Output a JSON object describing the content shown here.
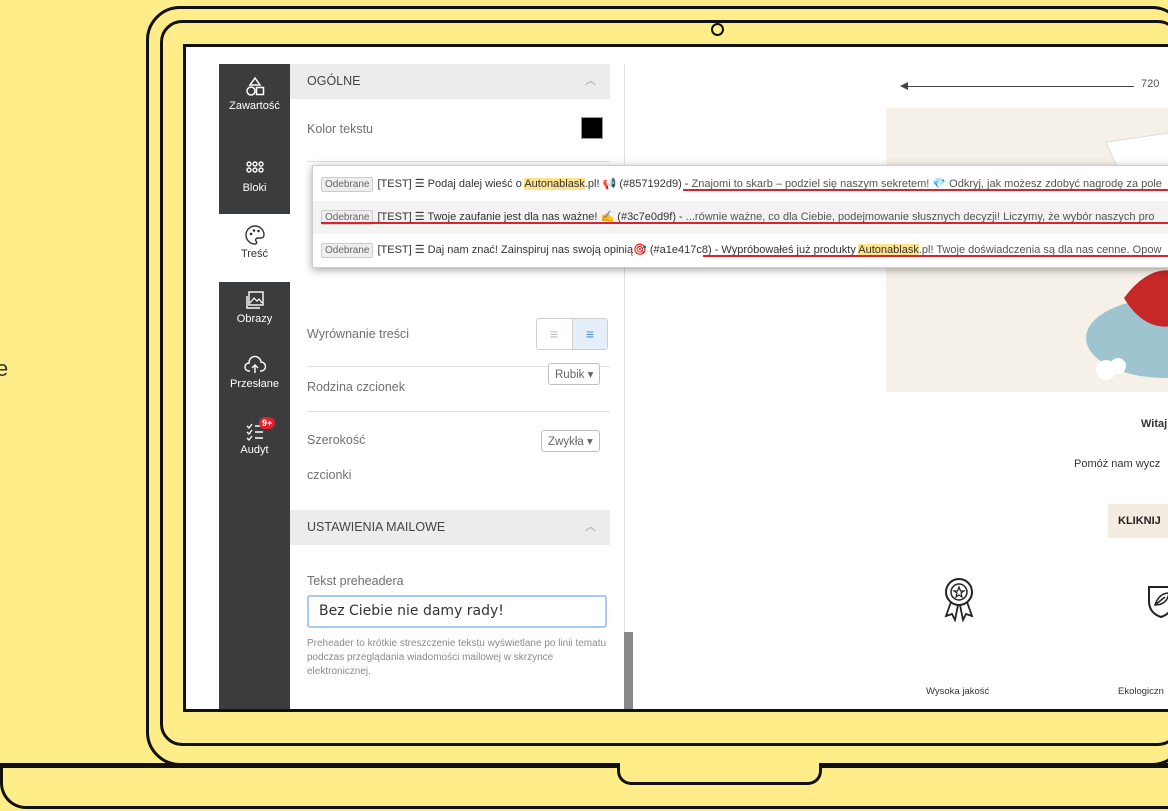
{
  "edge_letter": "e",
  "sidebar": {
    "items": [
      {
        "label": "Zawartość",
        "icon": "shapes-icon"
      },
      {
        "label": "Bloki",
        "icon": "blocks-grid-icon"
      },
      {
        "label": "Treść",
        "icon": "palette-icon"
      },
      {
        "label": "Obrazy",
        "icon": "images-icon"
      },
      {
        "label": "Przesłane",
        "icon": "upload-cloud-icon"
      },
      {
        "label": "Audyt",
        "icon": "checklist-icon",
        "badge": "9+"
      }
    ]
  },
  "panel": {
    "general_title": "OGÓLNE",
    "text_color_label": "Kolor tekstu",
    "text_color_value": "#000000",
    "alignment_label": "Wyrównanie treści",
    "font_family_label": "Rodzina czcionek",
    "font_family_value": "Rubik",
    "font_width_label_1": "Szerokość",
    "font_width_label_2": "czcionki",
    "font_width_value": "Zwykła",
    "mail_settings_title": "USTAWIENIA MAILOWE",
    "preheader_label": "Tekst preheadera",
    "preheader_value": "Bez Ciebie nie damy rady!",
    "preheader_help": "Preheader to krótkie streszczenie tekstu wyświetlane po linii tematu podczas przeglądania wiadomości mailowej w skrzynce elektronicznej."
  },
  "notifications": [
    {
      "tag": "Odebrane",
      "prefix": "[TEST] ☰ Podaj dalej wieść o ",
      "highlight": "Autonablask",
      "suffix": ".pl! 📢 (#857192d9) - ",
      "snippet": "Znajomi to skarb – podziel się naszym sekretem! 💎 Odkryj, jak możesz zdobyć nagrodę za pole"
    },
    {
      "tag": "Odebrane",
      "prefix": "[TEST] ☰ Twoje zaufanie jest dla nas ważne! ✍ (#3c7e0d9f) - ",
      "highlight": "",
      "suffix": "",
      "snippet": "...równie ważne, co dla Ciebie, podejmowanie słusznych decyzji! Liczymy, że wybór naszych pro"
    },
    {
      "tag": "Odebrane",
      "prefix": "[TEST] ☰ Daj nam znać! Zainspiruj nas swoją opinią🎯 (#a1e417c8) - Wypróbowałeś już produkty ",
      "highlight": "Autonablask",
      "suffix": "",
      "snippet": ".pl! Twoje doświadczenia są dla nas cenne. Opow"
    }
  ],
  "preview": {
    "width_label": "720",
    "greeting": "Witaj",
    "subtitle": "Pomóż nam wycz",
    "button_label": "KLIKNIJ",
    "feature_1": "Wysoka jakość",
    "feature_2": "Ekologiczn"
  }
}
